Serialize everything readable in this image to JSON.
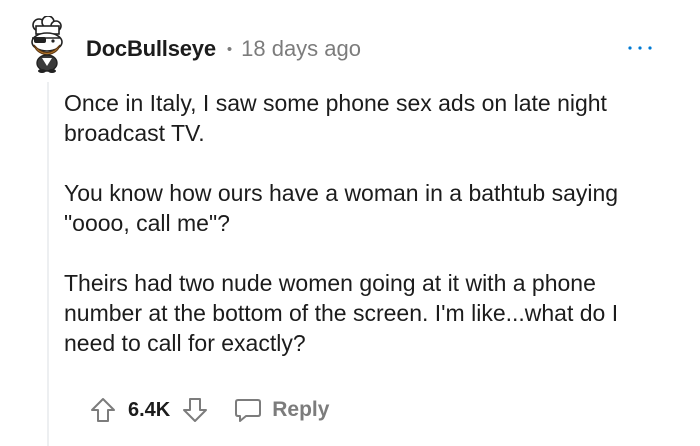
{
  "comment": {
    "author": "DocBullseye",
    "separator": "•",
    "time": "18 days ago",
    "paragraphs": [
      "Once in Italy, I saw some phone sex ads on late night broadcast TV.",
      "You know how ours have a woman in a bathtub saying \"oooo, call me\"?",
      "Theirs had two nude women going at it with a phone number at the bottom of the screen. I'm like...what do I need to call for exactly?"
    ],
    "score": "6.4K",
    "reply_label": "Reply"
  },
  "icons": {
    "avatar": "snoo-chef-avatar",
    "more": "more-options-icon",
    "upvote": "upvote-arrow-icon",
    "downvote": "downvote-arrow-icon",
    "reply": "speech-bubble-icon"
  },
  "colors": {
    "text": "#1c1c1c",
    "meta": "#7c7c7c",
    "thread_line": "#edeff1",
    "more_dots": "#0079d3"
  }
}
